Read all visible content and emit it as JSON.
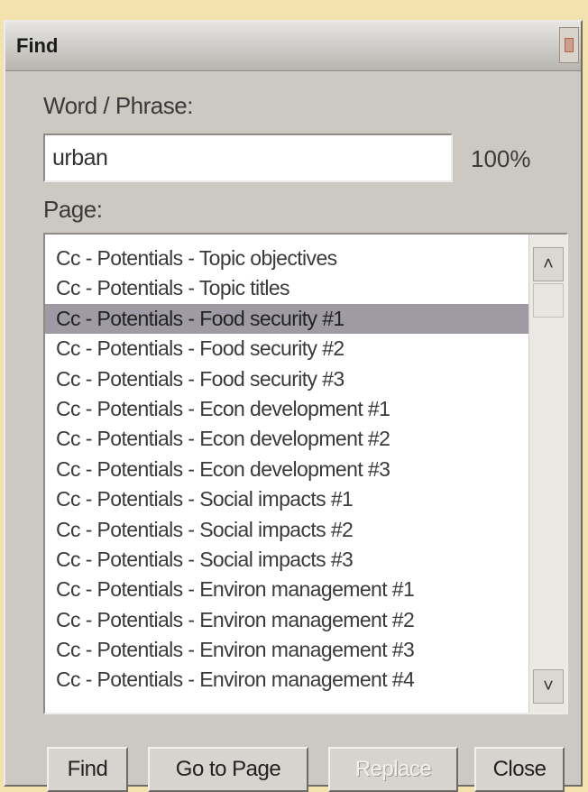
{
  "window": {
    "title": "Find"
  },
  "search": {
    "label": "Word / Phrase:",
    "value": "urban",
    "zoom": "100%"
  },
  "pages": {
    "label": "Page:",
    "selected_index": 2,
    "items": [
      "Cc - Potentials - Topic objectives",
      "Cc - Potentials - Topic titles",
      "Cc - Potentials - Food security #1",
      "Cc - Potentials - Food security #2",
      "Cc - Potentials - Food security #3",
      "Cc - Potentials - Econ development #1",
      "Cc - Potentials - Econ development #2",
      "Cc - Potentials - Econ development #3",
      "Cc - Potentials - Social impacts #1",
      "Cc - Potentials - Social impacts #2",
      "Cc - Potentials - Social impacts #3",
      "Cc - Potentials - Environ management #1",
      "Cc - Potentials - Environ management #2",
      "Cc - Potentials - Environ management #3",
      "Cc - Potentials - Environ management #4"
    ]
  },
  "buttons": {
    "find": "Find",
    "goto": "Go to Page",
    "replace": "Replace",
    "close": "Close"
  },
  "icons": {
    "scroll_up": "chevron-up-icon",
    "scroll_down": "chevron-down-icon",
    "close": "close-icon"
  }
}
